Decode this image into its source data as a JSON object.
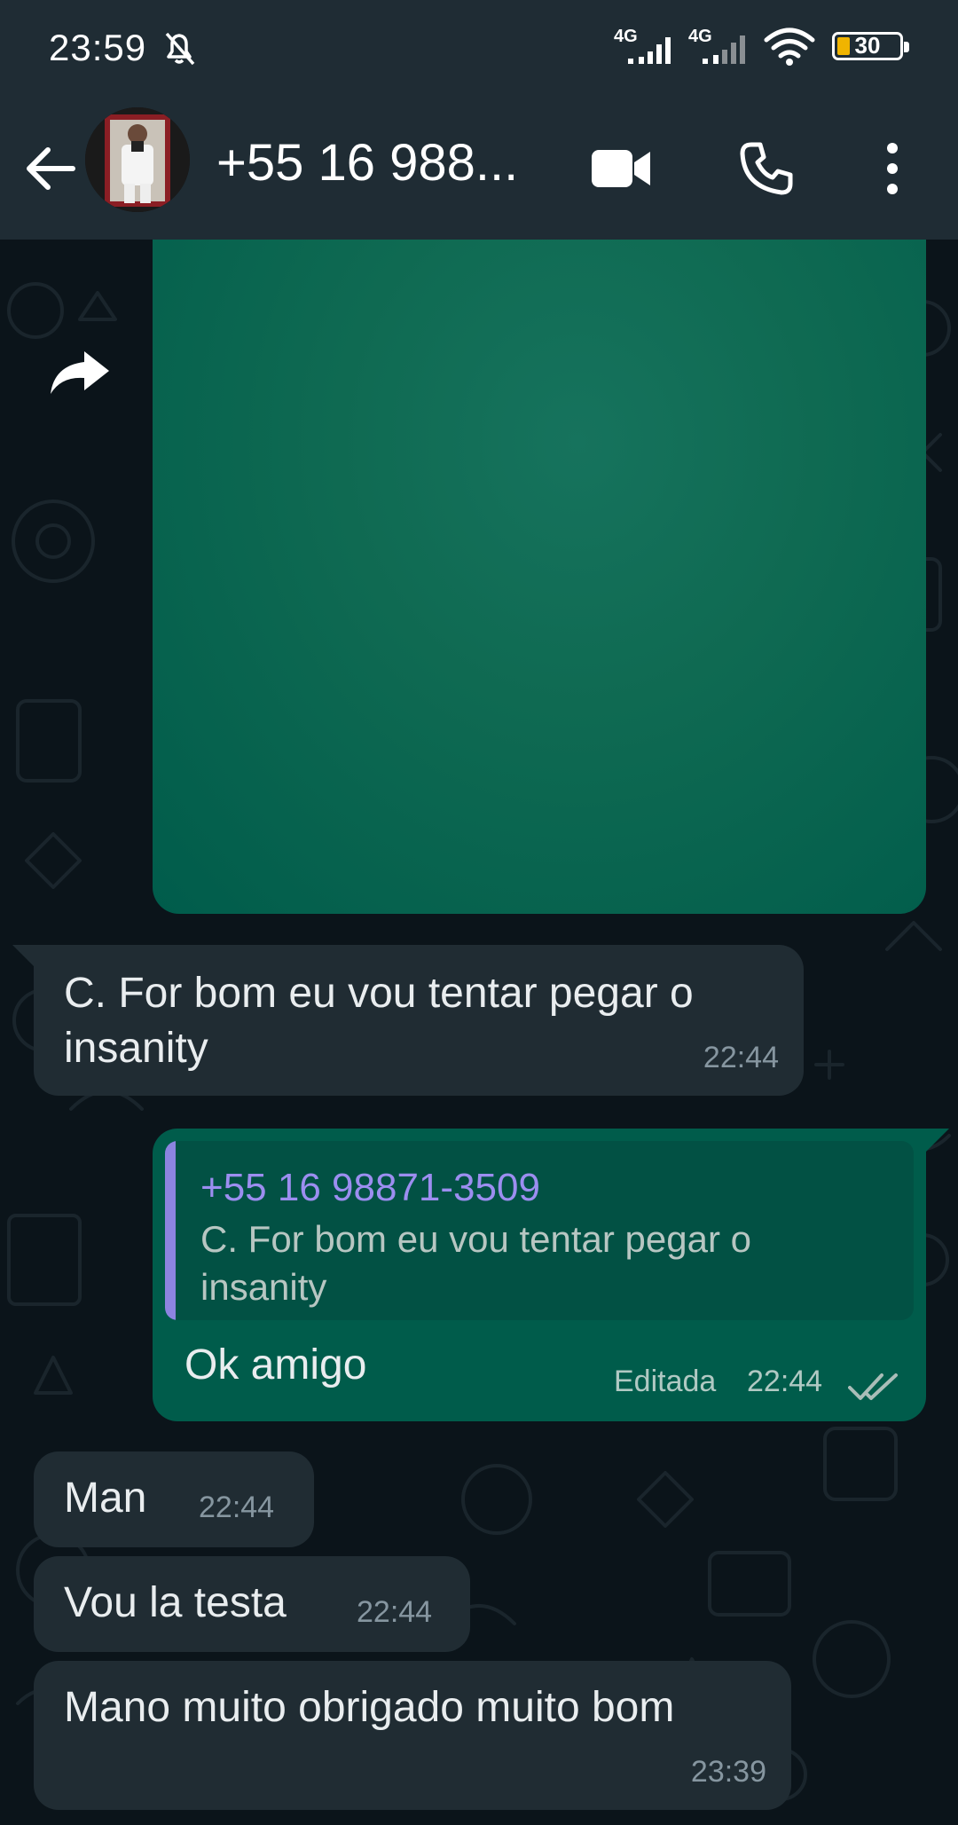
{
  "status_bar": {
    "time": "23:59",
    "network_1": "4G",
    "network_2": "4G",
    "battery_percent": "30"
  },
  "header": {
    "contact_name": "+55 16 988...",
    "icons": [
      "back-arrow-icon",
      "video-call-icon",
      "phone-call-icon",
      "more-options-icon"
    ]
  },
  "colors": {
    "header_bg": "#1f2c34",
    "chat_bg": "#0b141a",
    "incoming_bubble": "#202c33",
    "outgoing_bubble": "#005c4b",
    "quote_accent": "#8c84e0",
    "read_ticks": "#8696a0"
  },
  "messages": [
    {
      "type": "media",
      "direction": "out",
      "content": "green-image"
    },
    {
      "direction": "in",
      "text": "C. For bom eu vou tentar pegar o insanity",
      "time": "22:44"
    },
    {
      "direction": "out",
      "quote_author": "+55 16 98871-3509",
      "quote_text": "C. For bom eu vou tentar pegar o insanity",
      "text": "Ok amigo",
      "edited_label": "Editada",
      "time": "22:44",
      "status": "double-check-icon"
    },
    {
      "direction": "in",
      "text": "Man",
      "time": "22:44"
    },
    {
      "direction": "in",
      "text": "Vou la testa",
      "time": "22:44"
    },
    {
      "direction": "in",
      "text": "Mano muito obrigado muito bom",
      "time": "23:39"
    }
  ]
}
